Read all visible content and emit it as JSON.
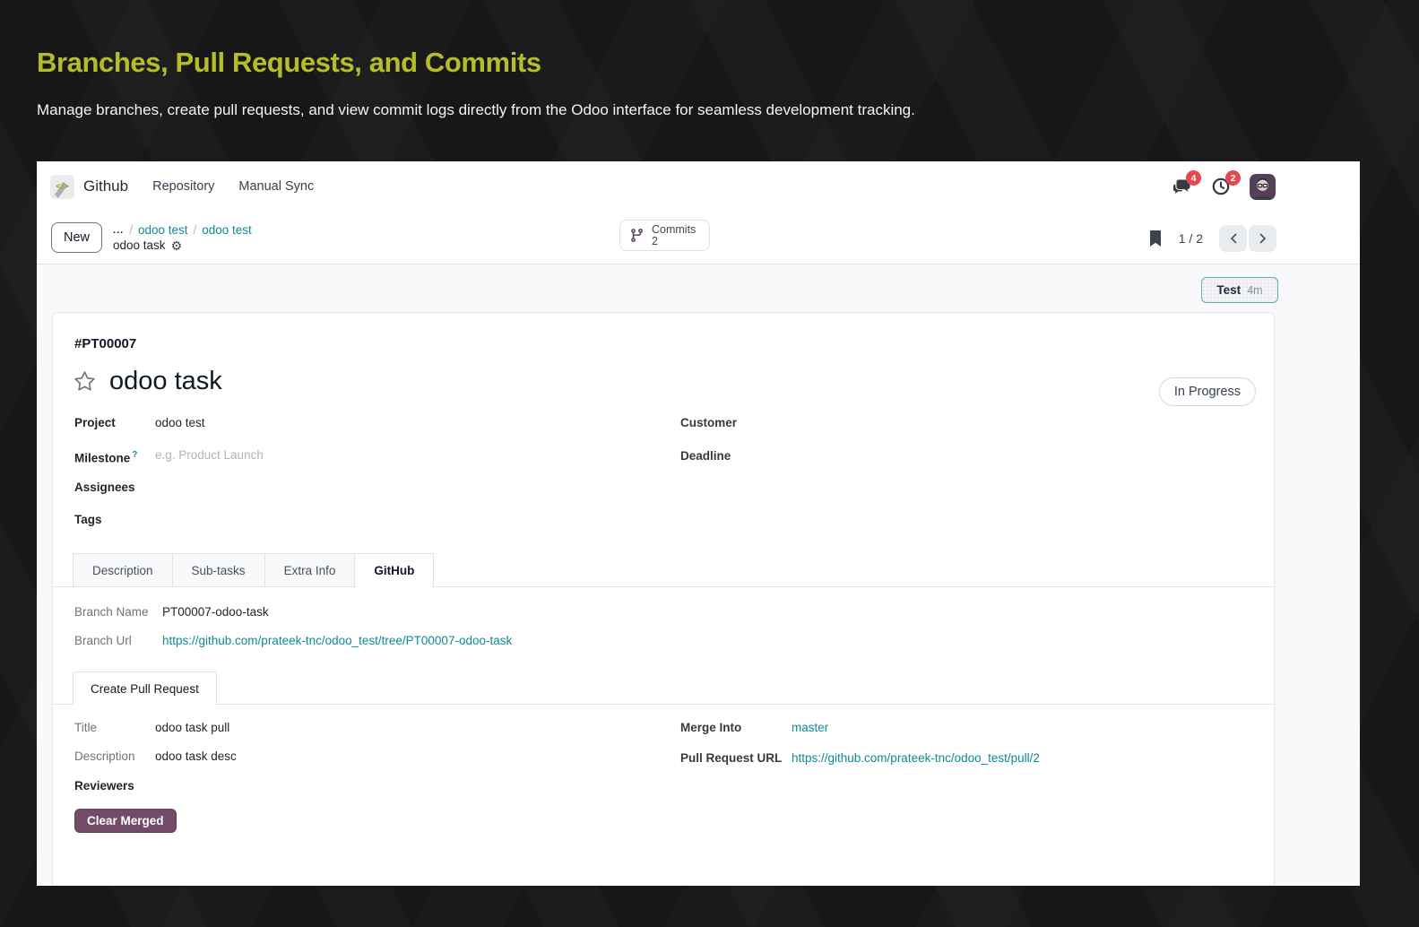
{
  "page": {
    "title": "Branches, Pull Requests, and Commits",
    "subtitle": "Manage branches, create pull requests, and view commit logs directly from the Odoo interface for seamless development tracking."
  },
  "colors": {
    "accent_olive": "#b5bd2b",
    "link_teal": "#0f8a94",
    "brand_purple": "#714b67",
    "badge_red": "#e5484d"
  },
  "nav": {
    "app_name": "Github",
    "menus": [
      {
        "label": "Repository"
      },
      {
        "label": "Manual Sync"
      }
    ],
    "messages_badge": "4",
    "activities_badge": "2"
  },
  "control_panel": {
    "new_button": "New",
    "breadcrumb_ellipsis": "...",
    "breadcrumb_links": [
      {
        "label": "odoo test"
      },
      {
        "label": "odoo test"
      }
    ],
    "breadcrumb_current": "odoo task",
    "commits_button": {
      "label": "Commits",
      "count": "2"
    },
    "pager": {
      "text": "1 / 2"
    }
  },
  "status_button": {
    "label": "Test",
    "time": "4m"
  },
  "task": {
    "reference": "#PT00007",
    "title": "odoo task",
    "stage": "In Progress",
    "fields_left": [
      {
        "label": "Project",
        "value": "odoo test"
      },
      {
        "label": "Milestone",
        "help": "?",
        "placeholder": "e.g. Product Launch"
      },
      {
        "label": "Assignees",
        "value": ""
      },
      {
        "label": "Tags",
        "value": ""
      }
    ],
    "fields_right": [
      {
        "label": "Customer",
        "value": ""
      },
      {
        "label": "Deadline",
        "value": ""
      }
    ],
    "tabs": [
      {
        "label": "Description"
      },
      {
        "label": "Sub-tasks"
      },
      {
        "label": "Extra Info"
      },
      {
        "label": "GitHub"
      }
    ],
    "github": {
      "branch_name_label": "Branch Name",
      "branch_name": "PT00007-odoo-task",
      "branch_url_label": "Branch Url",
      "branch_url": "https://github.com/prateek-tnc/odoo_test/tree/PT00007-odoo-task",
      "pr_tab_label": "Create Pull Request",
      "pr_left": [
        {
          "label": "Title",
          "value": "odoo task pull"
        },
        {
          "label": "Description",
          "value": "odoo task desc"
        }
      ],
      "pr_right": [
        {
          "label": "Merge Into",
          "value": "master"
        },
        {
          "label": "Pull Request URL",
          "value": "https://github.com/prateek-tnc/odoo_test/pull/2"
        }
      ],
      "reviewers_label": "Reviewers",
      "clear_merged_button": "Clear Merged"
    }
  }
}
